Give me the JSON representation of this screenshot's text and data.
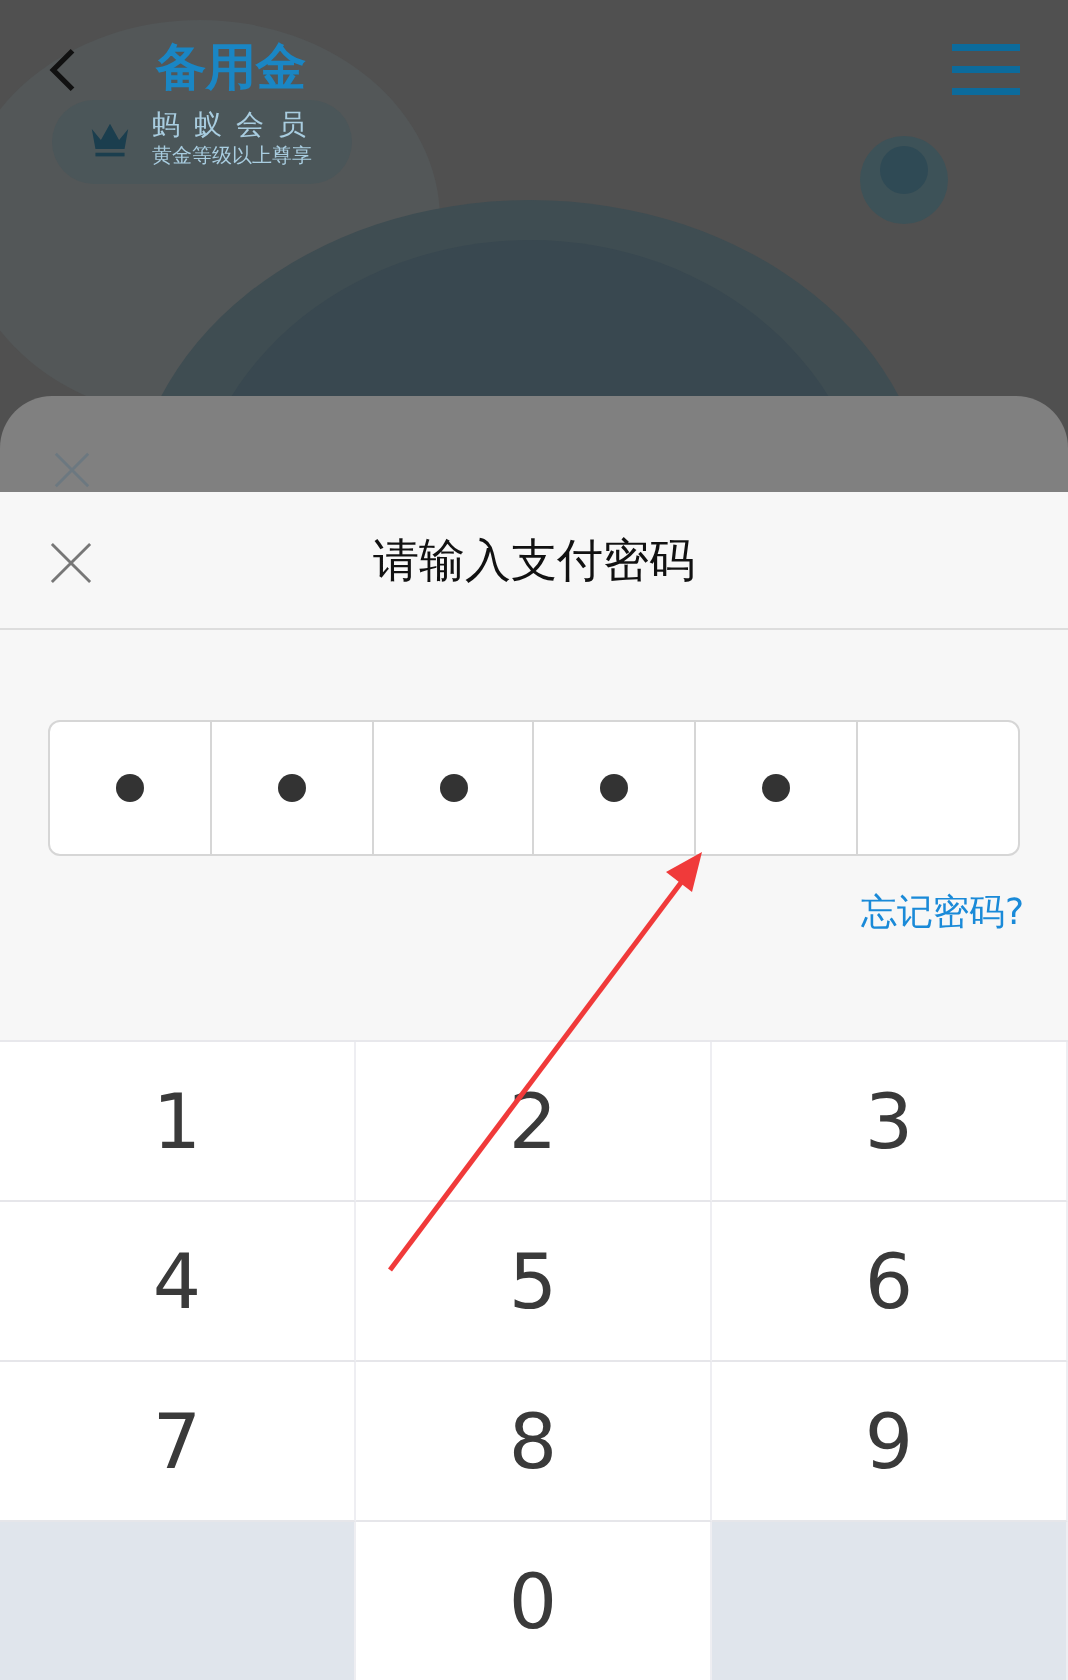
{
  "background_page": {
    "title": "备用金",
    "badge": {
      "title": "蚂蚁会员",
      "subtitle": "黄金等级以上尊享"
    }
  },
  "dialog": {
    "title": "请输入支付密码",
    "password_slots": [
      {
        "filled": true
      },
      {
        "filled": true
      },
      {
        "filled": true
      },
      {
        "filled": true
      },
      {
        "filled": true
      },
      {
        "filled": false
      }
    ],
    "forgot_link": "忘记密码?"
  },
  "keypad": [
    {
      "kind": "digit",
      "label": "1"
    },
    {
      "kind": "digit",
      "label": "2"
    },
    {
      "kind": "digit",
      "label": "3"
    },
    {
      "kind": "digit",
      "label": "4"
    },
    {
      "kind": "digit",
      "label": "5"
    },
    {
      "kind": "digit",
      "label": "6"
    },
    {
      "kind": "digit",
      "label": "7"
    },
    {
      "kind": "digit",
      "label": "8"
    },
    {
      "kind": "digit",
      "label": "9"
    },
    {
      "kind": "blank"
    },
    {
      "kind": "digit",
      "label": "0"
    },
    {
      "kind": "blank"
    }
  ]
}
